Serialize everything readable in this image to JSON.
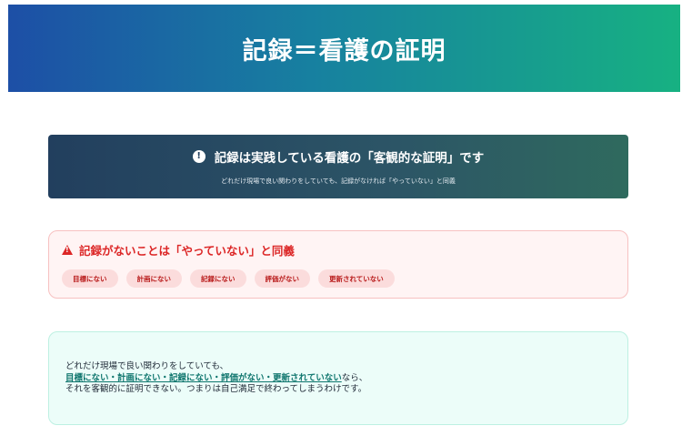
{
  "header": {
    "title": "記録＝看護の証明"
  },
  "dark_card": {
    "title": "記録は実践している看護の「客観的な証明」です",
    "subtitle": "どれだけ現場で良い関わりをしていても、記録がなければ「やっていない」と同義",
    "icon": "info-circle-icon"
  },
  "warning_card": {
    "title": "記録がないことは「やっていない」と同義",
    "icon": "warning-triangle-icon",
    "color": "#dc2626",
    "tags": [
      "目標にない",
      "計画にない",
      "記録にない",
      "評価がない",
      "更新されていない"
    ]
  },
  "note_card": {
    "line1": "どれだけ現場で良い関わりをしていても、",
    "line2_link": "目標にない・計画にない・記録にない・評価がない・更新されていない",
    "line2_rest": "なら、",
    "line3": "それを客観的に証明できない。つまりは自己満足で終わってしまうわけです。"
  }
}
